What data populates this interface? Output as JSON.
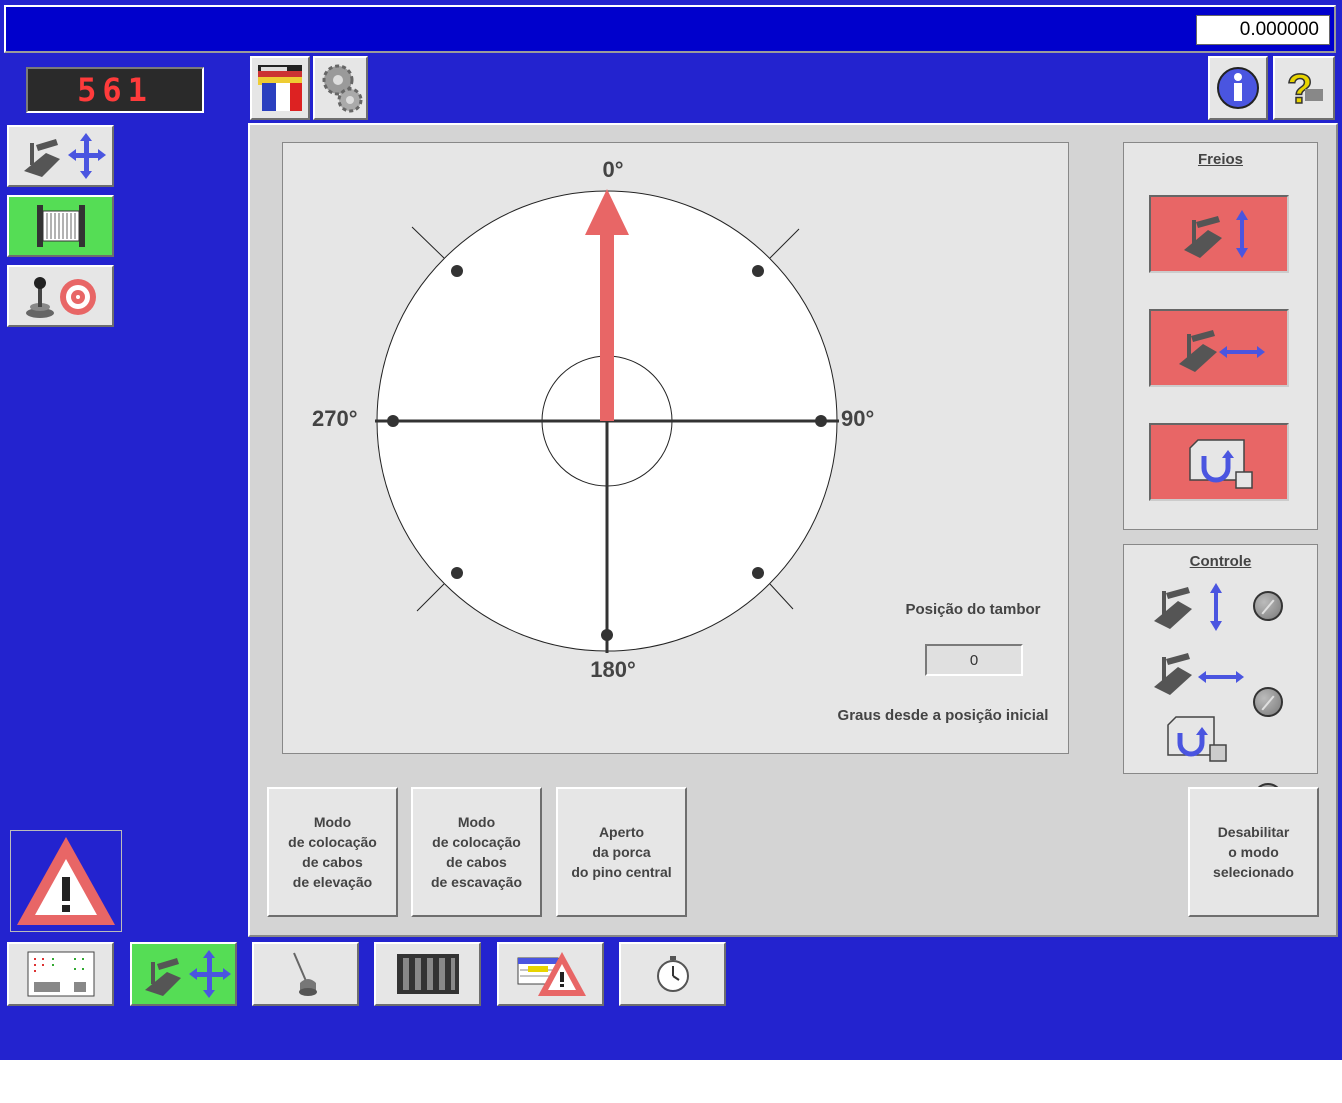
{
  "titlebar": {
    "value": "0.000000"
  },
  "counter": {
    "value": "561"
  },
  "toolbar": {
    "left_icons": [
      "language-flags-icon",
      "settings-gears-icon"
    ],
    "right_icons": [
      "info-icon",
      "help-icon"
    ]
  },
  "left_panel": {
    "buttons": [
      "movement-arrows-icon",
      "cable-drum-icon",
      "joystick-target-icon"
    ],
    "warning_icon": "warning-triangle-icon"
  },
  "dial": {
    "labels": {
      "top": "0°",
      "right": "90°",
      "bottom": "180°",
      "left": "270°"
    },
    "drum_position_label": "Posição do tambor",
    "drum_position_value": "0",
    "degrees_caption": "Graus desde a posição inicial",
    "arrow_angle_deg": 0,
    "arrow_color": "#e86666"
  },
  "brakes": {
    "title": "Freios",
    "buttons": [
      "hoist-brake-icon",
      "crowd-brake-icon",
      "swing-brake-icon"
    ],
    "active_color": "#e86666"
  },
  "control": {
    "title": "Controle",
    "rows": [
      "hoist-control-icon",
      "crowd-control-icon",
      "swing-control-icon"
    ]
  },
  "modes": [
    {
      "label": "Modo\nde colocação\nde cabos\nde elevação"
    },
    {
      "label": "Modo\nde colocação\nde cabos\nde escavação"
    },
    {
      "label": "Aperto\nda porca\ndo pino central"
    }
  ],
  "disable_button": {
    "label": "Desabilitar\no modo\nselecionado"
  },
  "bottom_nav": [
    "io-status-icon",
    "movement-arrows-icon",
    "lubrication-icon",
    "drive-rack-icon",
    "fault-log-icon",
    "timer-icon"
  ],
  "colors": {
    "background_blue": "#2323cf",
    "active_green": "#55dd55",
    "brake_red": "#e86666"
  }
}
